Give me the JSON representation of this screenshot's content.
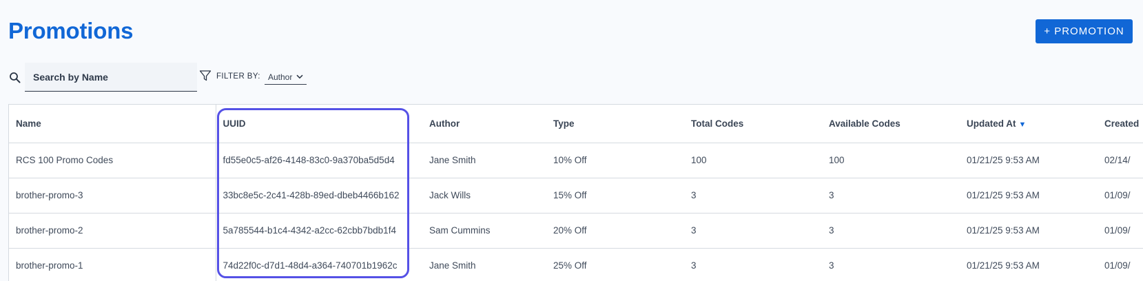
{
  "page": {
    "title": "Promotions"
  },
  "actions": {
    "add_promotion": "+ PROMOTION"
  },
  "search": {
    "placeholder": "Search by Name",
    "value": ""
  },
  "filter": {
    "label": "FILTER BY:",
    "selected": "Author"
  },
  "table": {
    "columns": [
      "Name",
      "UUID",
      "Author",
      "Type",
      "Total Codes",
      "Available Codes",
      "Updated At",
      "Created"
    ],
    "sorted_column": "Updated At",
    "sort_direction": "desc",
    "rows": [
      [
        "RCS 100 Promo Codes",
        "fd55e0c5-af26-4148-83c0-9a370ba5d5d4",
        "Jane Smith",
        "10% Off",
        "100",
        "100",
        "01/21/25 9:53 AM",
        "02/14/"
      ],
      [
        "brother-promo-3",
        "33bc8e5c-2c41-428b-89ed-dbeb4466b162",
        "Jack Wills",
        "15% Off",
        "3",
        "3",
        "01/21/25 9:53 AM",
        "01/09/"
      ],
      [
        "brother-promo-2",
        "5a785544-b1c4-4342-a2cc-62cbb7bdb1f4",
        "Sam Cummins",
        "20% Off",
        "3",
        "3",
        "01/21/25 9:53 AM",
        "01/09/"
      ],
      [
        "brother-promo-1",
        "74d22f0c-d7d1-48d4-a364-740701b1962c",
        "Jane Smith",
        "25% Off",
        "3",
        "3",
        "01/21/25 9:53 AM",
        "01/09/"
      ]
    ]
  },
  "colors": {
    "accent": "#1167d6",
    "highlight_outline": "#5551e6",
    "page_background": "#f8fafd"
  },
  "icons": {
    "search": "search-icon",
    "filter": "filter-icon",
    "dropdown": "chevron-down-icon",
    "sort": "sort-desc-icon"
  }
}
